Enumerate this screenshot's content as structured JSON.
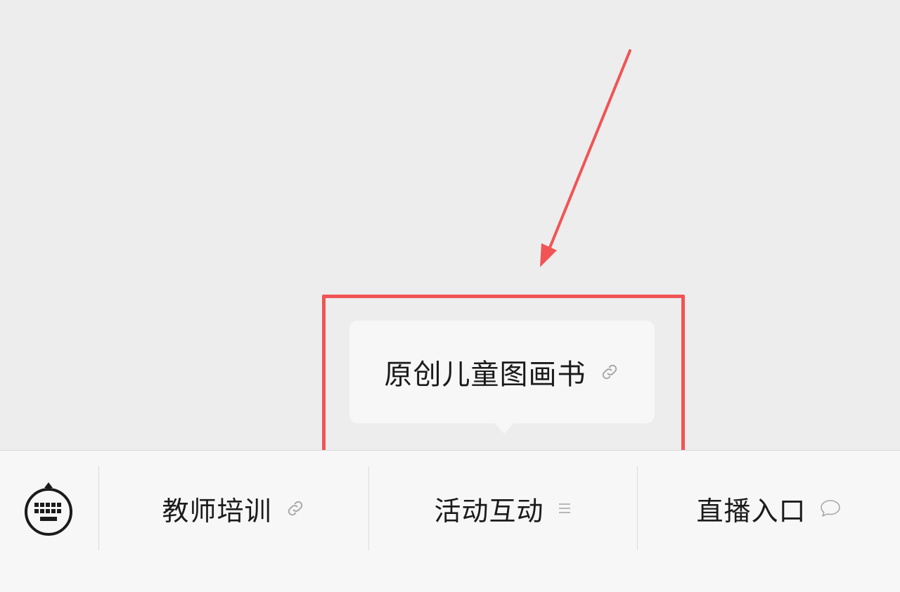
{
  "popup": {
    "label": "原创儿童图画书",
    "icon": "link-icon"
  },
  "bottom_bar": {
    "keyboard_icon": "keyboard-toggle-icon",
    "items": [
      {
        "label": "教师培训",
        "icon": "link-icon"
      },
      {
        "label": "活动互动",
        "icon": "menu-icon"
      },
      {
        "label": "直播入口",
        "icon": "chat-bubble-icon"
      }
    ]
  },
  "colors": {
    "annotation": "#f15454",
    "page_background": "#ededed",
    "bar_background": "#f7f7f7",
    "icon_gray": "#a8a8a8"
  }
}
